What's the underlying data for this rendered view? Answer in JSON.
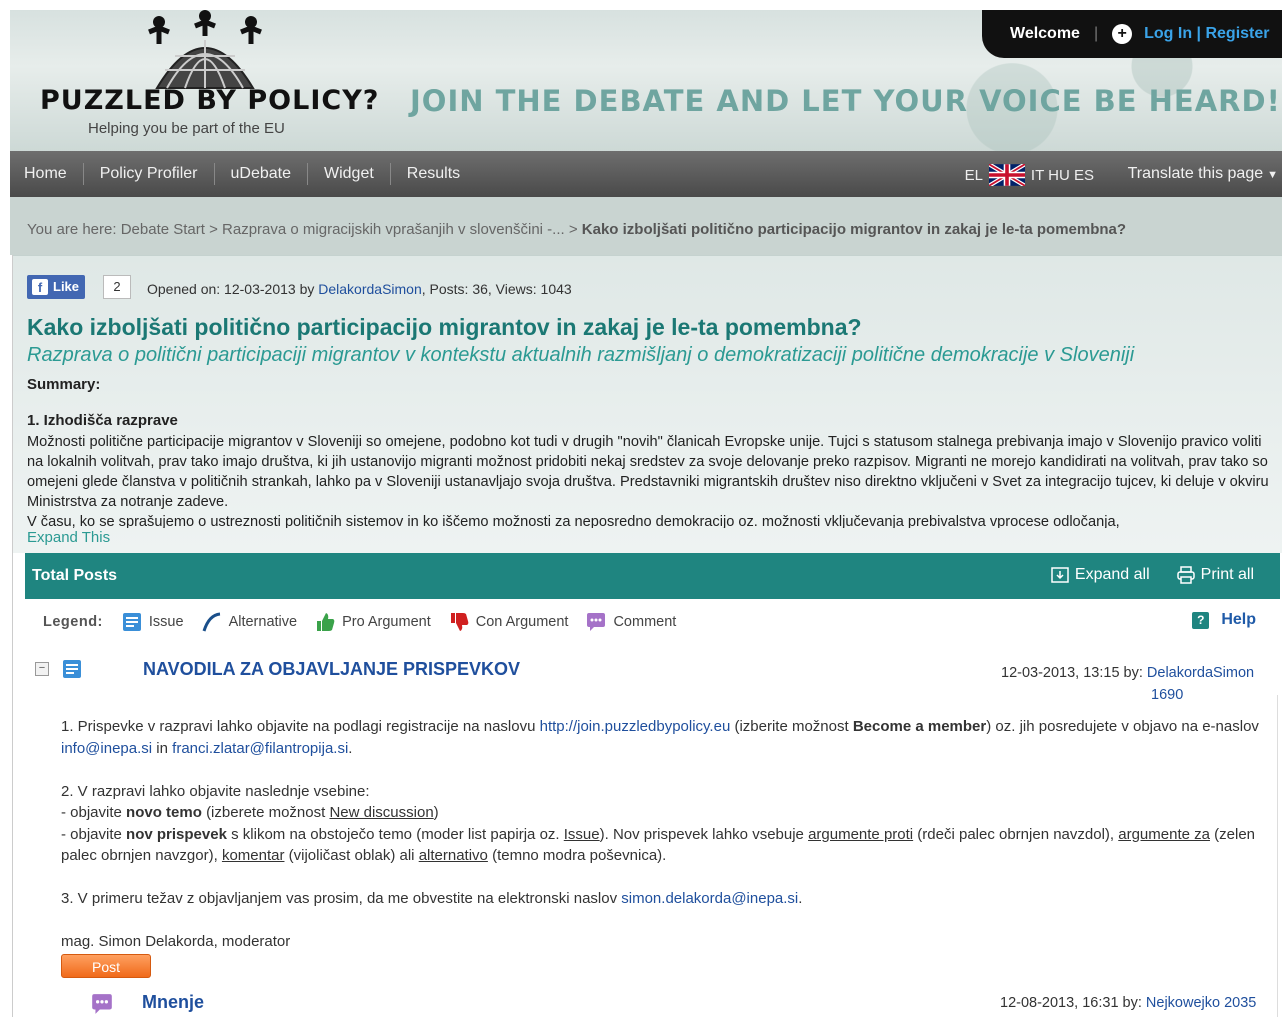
{
  "header": {
    "welcome": "Welcome",
    "login": "Log In | Register",
    "logo_text": "PUZZLED BY POLICY?",
    "logo_sub": "Helping you be part of the EU",
    "slogan": "JOIN THE DEBATE AND LET YOUR VOICE BE HEARD!"
  },
  "nav": {
    "items": [
      "Home",
      "Policy Profiler",
      "uDebate",
      "Widget",
      "Results"
    ],
    "lang_el": "EL",
    "lang_others": "IT HU ES",
    "translate": "Translate this page"
  },
  "breadcrumb": {
    "prefix": "You are here:",
    "start": "Debate Start",
    "parent": "Razprava o migracijskih vprašanjih v slovenščini -...",
    "current": "Kako izboljšati politično participacijo migrantov in zakaj je le-ta pomembna?",
    "sep": ">"
  },
  "discussion": {
    "like_label": "Like",
    "like_count": "2",
    "opened_prefix": "Opened on: 12-03-2013 by",
    "author": "DelakordaSimon",
    "stats": ", Posts: 36, Views: 1043",
    "title": "Kako izboljšati politično participacijo migrantov in zakaj je le-ta pomembna?",
    "subtitle": "Razprava o politični participaciji migrantov v kontekstu aktualnih razmišljanj o demokratizaciji politične demokracije v Sloveniji",
    "summary_label": "Summary:",
    "summary_heading": "1. Izhodišča razprave",
    "summary_p1": "Možnosti politične participacije migrantov v Sloveniji so omejene, podobno kot tudi v drugih \"novih\" članicah Evropske unije. Tujci s statusom stalnega prebivanja imajo v Slovenijo pravico voliti na lokalnih volitvah, prav tako imajo društva, ki jih ustanovijo migranti možnost pridobiti nekaj sredstev za svoje delovanje preko razpisov. Migranti ne morejo kandidirati na volitvah, prav tako so omejeni glede članstva v političnih strankah, lahko pa v Sloveniji ustanavljajo svoja društva. Predstavniki migrantskih društev niso direktno vključeni v Svet za integracijo tujcev, ki deluje v okviru Ministrstva za notranje zadeve.",
    "summary_p2": "V času, ko se sprašujemo o ustreznosti političnih sistemov in ko iščemo možnosti za neposredno demokracijo oz. možnosti vključevanja prebivalstva vprocese odločanja,",
    "expand_this": "Expand This"
  },
  "posts_bar": {
    "label": "Total Posts",
    "expand_all": "Expand all",
    "print_all": "Print all"
  },
  "legend": {
    "title": "Legend:",
    "items": [
      "Issue",
      "Alternative",
      "Pro Argument",
      "Con Argument",
      "Comment"
    ],
    "help": "Help"
  },
  "post": {
    "title": "NAVODILA ZA OBJAVLJANJE PRISPEVKOV",
    "date": "12-03-2013, 13:15 by:",
    "author": "DelakordaSimon",
    "author_score": "1690",
    "line1a": "1. Prispevke v razpravi lahko objavite na podlagi registracije na naslovu",
    "line1_url": "http://join.puzzledbypolicy.eu",
    "line1b": "(izberite možnost",
    "line1_bold": "Become a member",
    "line1c": ") oz. jih posredujete v objavo na e-naslov",
    "email1": "info@inepa.si",
    "line1_in": "in",
    "email2": "franci.zlatar@filantropija.si",
    "line1_end": ".",
    "line2": "2. V razpravi lahko objavite naslednje vsebine:",
    "line3a": "- objavite",
    "line3_bold": "novo temo",
    "line3b": "(izberete možnost",
    "line3_u": "New discussion",
    "line3c": ")",
    "line4a": "- objavite",
    "line4_bold": "nov prispevek",
    "line4b": "s klikom na obstoječo temo (moder list papirja oz.",
    "line4_u1": "Issue",
    "line4c": "). Nov prispevek lahko vsebuje",
    "line4_u2": "argumente proti",
    "line4d": "(rdeči palec obrnjen navzdol),",
    "line4_u3": "argumente za",
    "line4e": "(zelen palec obrnjen navzgor),",
    "line4_u4": "komentar",
    "line4f": "(vijoličast oblak) ali",
    "line4_u5": "alternativo",
    "line4g": "(temno modra poševnica).",
    "line5a": "3. V primeru težav z objavljanjem vas prosim, da me obvestite na elektronski naslov",
    "email3": "simon.delakorda@inepa.si",
    "line5_end": ".",
    "signature": "mag. Simon Delakorda, moderator",
    "post_button": "Post"
  },
  "reply": {
    "title": "Mnenje",
    "date": "12-08-2013, 16:31 by:",
    "author": "Nejkowejko 2035"
  }
}
